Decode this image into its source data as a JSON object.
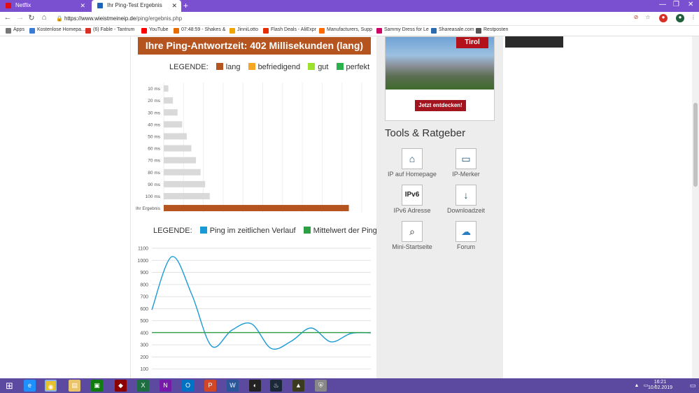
{
  "browser": {
    "tabs": [
      {
        "title": "Netflix",
        "active": false,
        "favicon_color": "#e50914"
      },
      {
        "title": "Ihr Ping-Test Ergebnis",
        "active": true,
        "favicon_color": "#1e63b8"
      }
    ],
    "url_host": "https://www.wieistmeineip.de",
    "url_path": "/ping/ergebnis.php",
    "bookmarks": [
      {
        "label": "Apps",
        "color": "#777"
      },
      {
        "label": "Kostenlose Homepa...",
        "color": "#3a7bd5"
      },
      {
        "label": "(6) Fable - Tantrum",
        "color": "#d93025"
      },
      {
        "label": "YouTube",
        "color": "#ff0000"
      },
      {
        "label": "07:48:59 - Shakes &",
        "color": "#e66b00"
      },
      {
        "label": "JinniLotto",
        "color": "#f0a500"
      },
      {
        "label": "Flash Deals - AliExpr",
        "color": "#e62e04"
      },
      {
        "label": "Manufacturers, Supp",
        "color": "#ff6a00"
      },
      {
        "label": "Sammy Dress for Le",
        "color": "#cc0066"
      },
      {
        "label": "Shareasale.com",
        "color": "#2b6cb0"
      },
      {
        "label": "Restposten",
        "color": "#555"
      }
    ]
  },
  "result": {
    "headline": "Ihre Ping-Antwortzeit: 402 Millisekunden (lang)"
  },
  "legend1": {
    "title": "LEGENDE:",
    "items": [
      {
        "label": "lang",
        "color": "#b5541f"
      },
      {
        "label": "befriedigend",
        "color": "#f5a623"
      },
      {
        "label": "gut",
        "color": "#9be22d"
      },
      {
        "label": "perfekt",
        "color": "#2bb24c"
      }
    ]
  },
  "legend2": {
    "title": "LEGENDE:",
    "items": [
      {
        "label": "Ping im zeitlichen Verlauf",
        "color": "#1a9ad6"
      },
      {
        "label": "Mittelwert der Pingzeiten",
        "color": "#2ea043"
      }
    ]
  },
  "chart_data": [
    {
      "type": "bar",
      "orientation": "horizontal",
      "categories": [
        "10 ms",
        "20 ms",
        "30 ms",
        "40 ms",
        "50 ms",
        "60 ms",
        "70 ms",
        "80 ms",
        "90 ms",
        "100 ms",
        "Ihr Ergebnis"
      ],
      "values": [
        10,
        20,
        30,
        40,
        50,
        60,
        70,
        80,
        90,
        100,
        402
      ],
      "colors": [
        "#d9d9d9",
        "#d9d9d9",
        "#d9d9d9",
        "#d9d9d9",
        "#d9d9d9",
        "#d9d9d9",
        "#d9d9d9",
        "#d9d9d9",
        "#d9d9d9",
        "#d9d9d9",
        "#b5541f"
      ],
      "xlim": [
        0,
        430
      ],
      "grid": true
    },
    {
      "type": "line",
      "x": [
        0,
        1,
        2,
        3,
        4,
        5,
        6,
        7,
        8,
        9,
        10,
        11
      ],
      "series": [
        {
          "name": "Ping im zeitlichen Verlauf",
          "values": [
            590,
            1030,
            720,
            290,
            420,
            475,
            270,
            330,
            440,
            325,
            395,
            400
          ],
          "color": "#1a9ad6"
        },
        {
          "name": "Mittelwert der Pingzeiten",
          "values": [
            402,
            402,
            402,
            402,
            402,
            402,
            402,
            402,
            402,
            402,
            402,
            402
          ],
          "color": "#2ea043"
        }
      ],
      "yticks": [
        100,
        200,
        300,
        400,
        500,
        600,
        700,
        800,
        900,
        1000,
        1100
      ],
      "ylim": [
        0,
        1100
      ],
      "grid": true
    }
  ],
  "sidebar": {
    "ad_brand": "Tirol",
    "ad_button": "Jetzt entdecken!",
    "tools_title": "Tools & Ratgeber",
    "tools": [
      {
        "label": "IP auf Homepage",
        "glyph": "⌂"
      },
      {
        "label": "IP-Merker",
        "glyph": "▭"
      },
      {
        "label": "IPv6 Adresse",
        "glyph": "IPv6"
      },
      {
        "label": "Downloadzeit",
        "glyph": "↓"
      },
      {
        "label": "Mini-Startseite",
        "glyph": "⌕"
      },
      {
        "label": "Forum",
        "glyph": "☁"
      }
    ]
  },
  "taskbar": {
    "time": "16:21",
    "date": "10.02.2019"
  }
}
